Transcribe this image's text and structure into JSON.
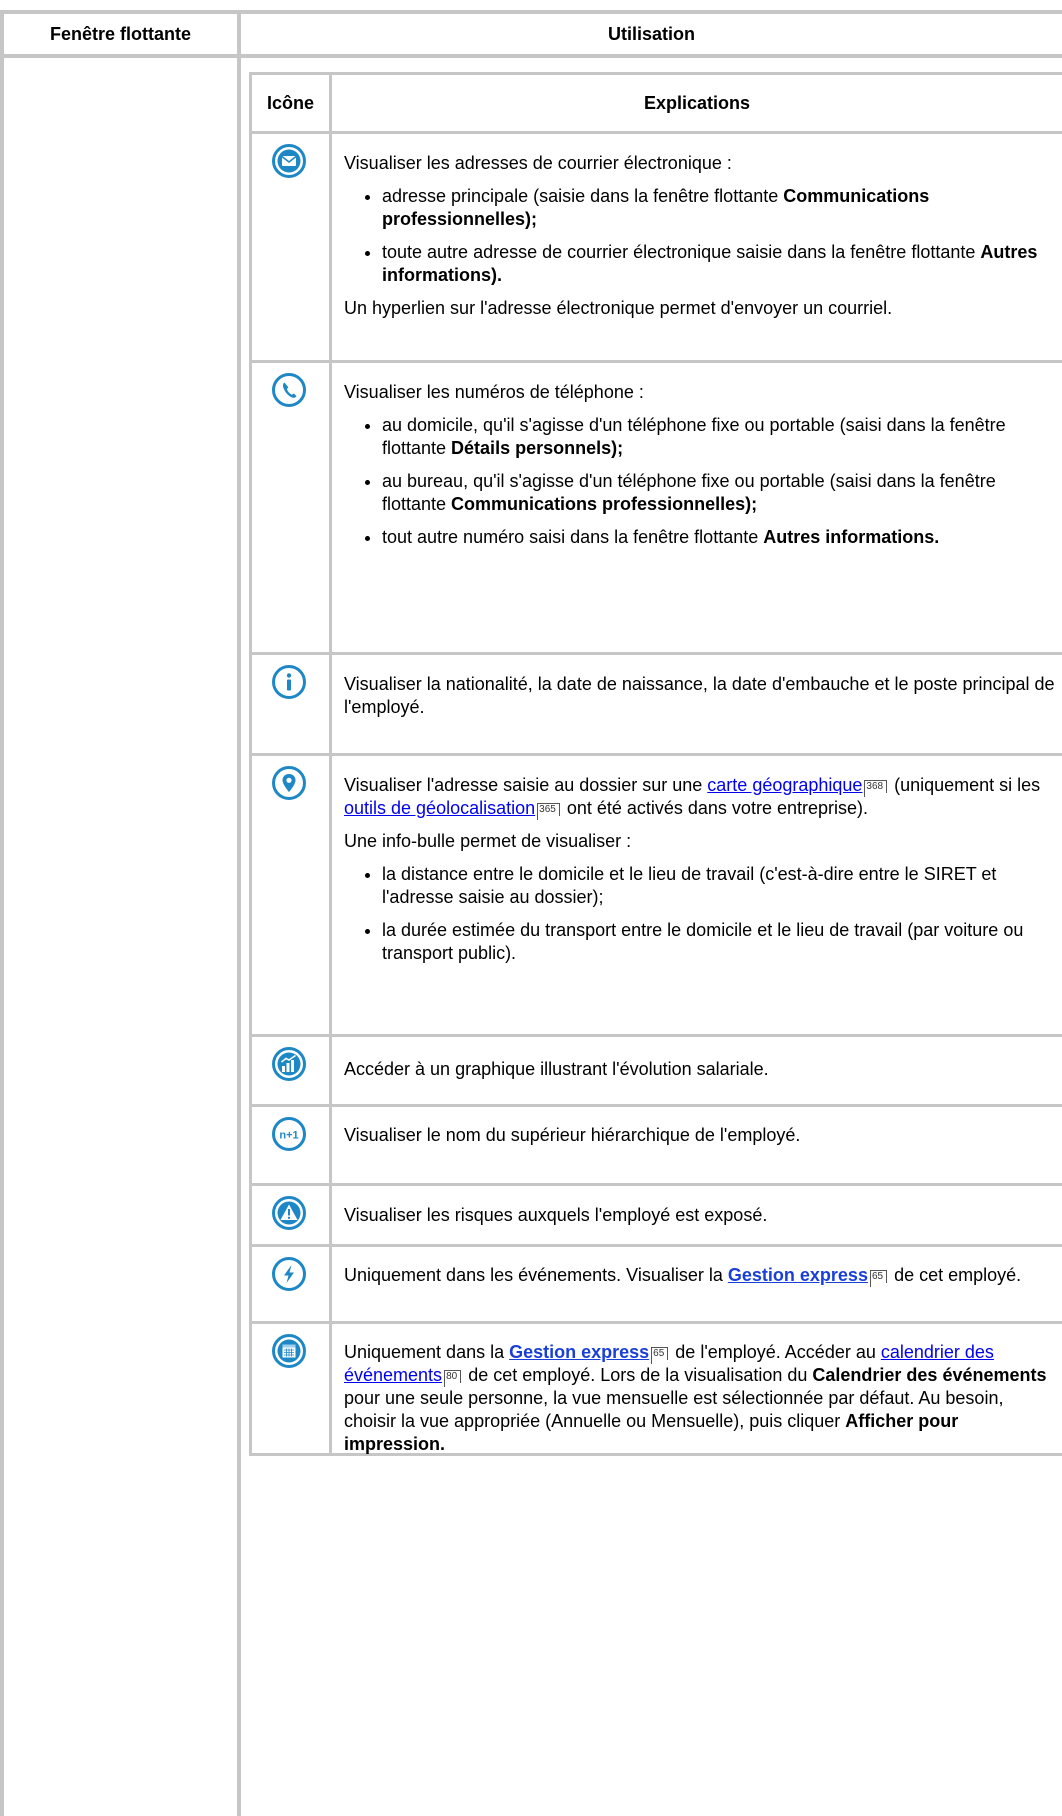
{
  "outer_headers": {
    "col1": "Fenêtre flottante",
    "col2": "Utilisation"
  },
  "inner_headers": {
    "col1": "Icône",
    "col2": "Explications"
  },
  "rows": {
    "email": {
      "icon": "envelope-icon",
      "intro": "Visualiser les adresses de courrier électronique :",
      "b1_text": "adresse principale (saisie dans la fenêtre flottante ",
      "b1_bold": "Communications professionnelles);",
      "b2_text": "toute autre adresse de courrier électronique saisie dans la fenêtre flottante ",
      "b2_bold": "Autres informations).",
      "outro": "Un hyperlien sur l'adresse électronique permet d'envoyer un courriel."
    },
    "phone": {
      "icon": "phone-icon",
      "intro": "Visualiser les numéros de téléphone :",
      "b1_text": "au domicile, qu'il s'agisse d'un téléphone fixe ou portable (saisi dans la fenêtre flottante ",
      "b1_bold": "Détails personnels);",
      "b2_text": "au bureau, qu'il s'agisse d'un téléphone fixe ou portable (saisi dans la fenêtre flottante ",
      "b2_bold": "Communications professionnelles);",
      "b3_text": "tout autre numéro saisi dans la fenêtre flottante ",
      "b3_bold": "Autres informations."
    },
    "info": {
      "icon": "info-icon",
      "text": "Visualiser la nationalité, la date de naissance, la date d'embauche et le poste principal de l'employé."
    },
    "map": {
      "icon": "map-pin-icon",
      "t1": "Visualiser l'adresse saisie au dossier sur une ",
      "link1": "carte géographique",
      "ref1": "368",
      "t2": " (uniquement si les ",
      "link2": "outils de géolocalisation",
      "ref2": "365",
      "t3": " ont été activés dans votre entreprise).",
      "p2": "Une info-bulle permet de visualiser :",
      "b1": "la distance entre le domicile et le lieu de travail (c'est-à-dire entre le SIRET et l'adresse saisie au dossier);",
      "b2": "la durée estimée du transport entre le domicile et le lieu de travail (par voiture ou transport public)."
    },
    "chart": {
      "icon": "salary-chart-icon",
      "text": "Accéder à un graphique illustrant l'évolution salariale."
    },
    "manager": {
      "icon": "n-plus-1-icon",
      "icon_label": "n+1",
      "text": "Visualiser le nom du supérieur hiérarchique de l'employé."
    },
    "risk": {
      "icon": "warning-icon",
      "text": "Visualiser les risques auxquels l'employé est exposé."
    },
    "express": {
      "icon": "lightning-icon",
      "t1": "Uniquement dans les événements. Visualiser la ",
      "link": "Gestion express",
      "ref": "65",
      "t2": " de cet employé."
    },
    "calendar": {
      "icon": "calendar-icon",
      "t1": "Uniquement dans la ",
      "link1": "Gestion express",
      "ref1": "65",
      "t2": " de l'employé. Accéder au ",
      "link2": "calendrier des événements",
      "ref2": "80",
      "t3": " de cet employé. Lors de la visualisation du ",
      "bold1": "Calendrier des événements",
      "t4": " pour une seule personne, la vue mensuelle est sélectionnée par défaut. Au besoin, choisir la vue appropriée (Annuelle ou Mensuelle), puis cliquer ",
      "bold2": "Afficher pour impression."
    }
  },
  "colors": {
    "border": "#c6c6c6",
    "icon_blue": "#1e88c7",
    "link": "#0000ee"
  }
}
